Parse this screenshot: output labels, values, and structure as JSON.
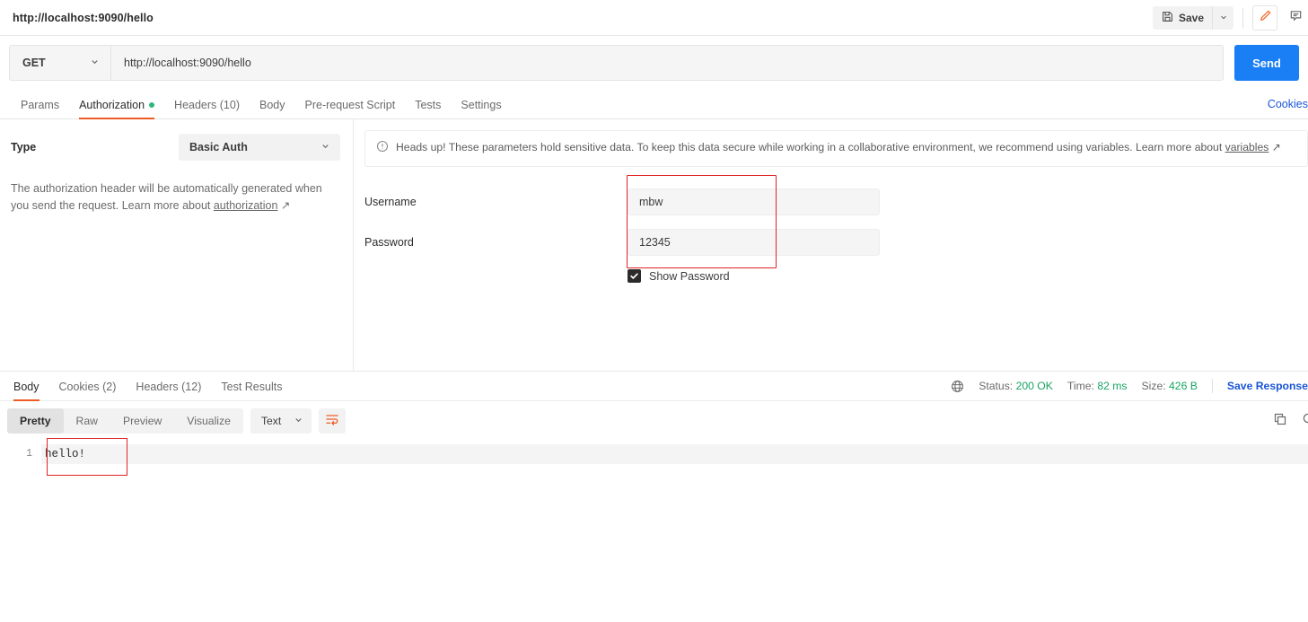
{
  "topbar": {
    "tab_title": "http://localhost:9090/hello",
    "save_label": "Save",
    "save_icon": "floppy-disk-icon",
    "caret_icon": "chevron-down-icon",
    "edit_icon": "pencil-icon",
    "comment_icon": "comment-icon",
    "accent": "#ef5b25"
  },
  "request": {
    "method": "GET",
    "url": "http://localhost:9090/hello",
    "send_label": "Send",
    "send_color": "#1a7ef5"
  },
  "request_tabs": [
    {
      "label": "Params",
      "active": false,
      "dot": false
    },
    {
      "label": "Authorization",
      "active": true,
      "dot": true
    },
    {
      "label": "Headers (10)",
      "active": false,
      "dot": false
    },
    {
      "label": "Body",
      "active": false,
      "dot": false
    },
    {
      "label": "Pre-request Script",
      "active": false,
      "dot": false
    },
    {
      "label": "Tests",
      "active": false,
      "dot": false
    },
    {
      "label": "Settings",
      "active": false,
      "dot": false
    }
  ],
  "cookies_link": "Cookies",
  "auth": {
    "type_label": "Type",
    "type_value": "Basic Auth",
    "note_text": "The authorization header will be automatically generated when you send the request. Learn more about ",
    "note_link": "authorization",
    "notice_icon": "info-circle-icon",
    "notice_text": "Heads up! These parameters hold sensitive data. To keep this data secure while working in a collaborative environment, we recommend using variables. Learn more about ",
    "notice_link": "variables",
    "username_label": "Username",
    "username_value": "mbw",
    "password_label": "Password",
    "password_value": "12345",
    "show_password_label": "Show Password",
    "show_password_checked": true,
    "annotation_color": "#e02424"
  },
  "response_tabs": [
    {
      "label": "Body",
      "active": true
    },
    {
      "label": "Cookies (2)",
      "active": false
    },
    {
      "label": "Headers (12)",
      "active": false
    },
    {
      "label": "Test Results",
      "active": false
    }
  ],
  "response_meta": {
    "globe_icon": "globe-icon",
    "status_label": "Status:",
    "status_value": "200 OK",
    "time_label": "Time:",
    "time_value": "82 ms",
    "size_label": "Size:",
    "size_value": "426 B",
    "save_response": "Save Response",
    "value_color": "#19a463"
  },
  "body_toolbar": {
    "views": [
      {
        "label": "Pretty",
        "active": true
      },
      {
        "label": "Raw",
        "active": false
      },
      {
        "label": "Preview",
        "active": false
      },
      {
        "label": "Visualize",
        "active": false
      }
    ],
    "format_value": "Text",
    "format_caret": "chevron-down-icon",
    "wrap_icon": "wrap-text-icon",
    "copy_icon": "copy-icon",
    "search_icon": "search-icon"
  },
  "response_body": {
    "line_number": "1",
    "content": "hello!"
  }
}
